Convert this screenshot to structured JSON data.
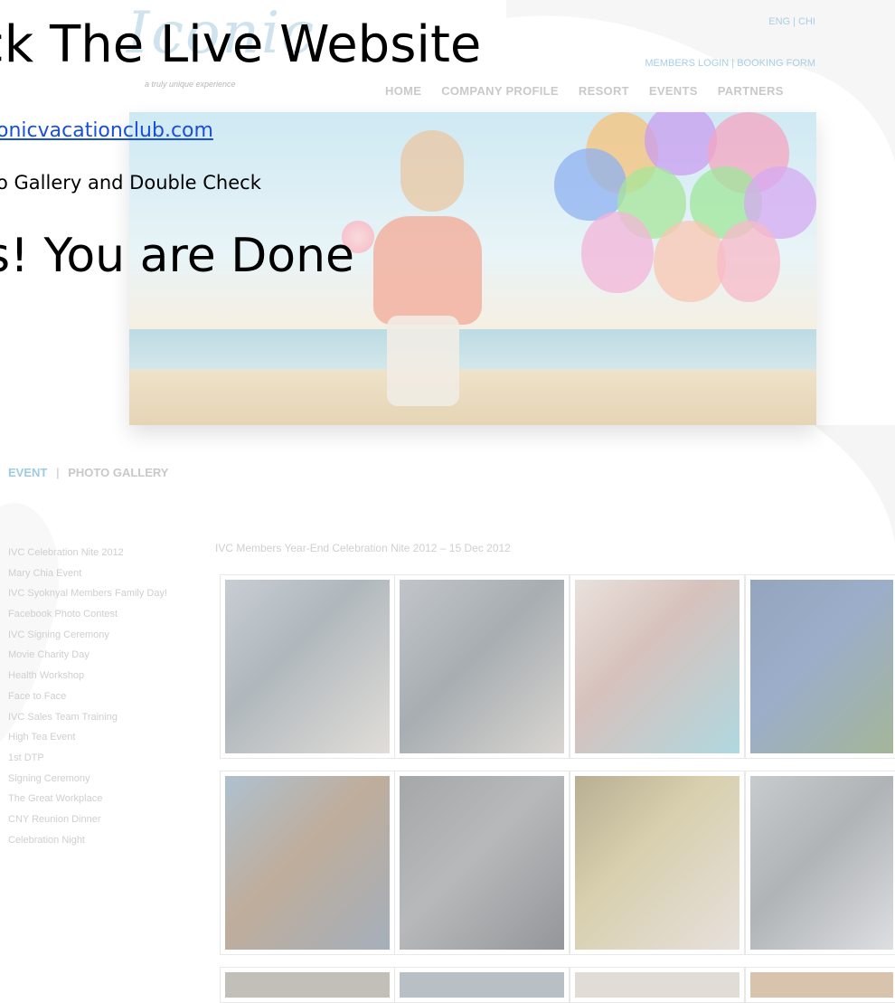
{
  "slide": {
    "heading": "ck The Live Website",
    "url": "onicvacationclub.com",
    "instruction": "o Gallery and Double Check",
    "done": "s! You are Done"
  },
  "site": {
    "lang": "ENG | CHI",
    "login_links": "MEMBERS LOGIN | BOOKING FORM",
    "tagline": "a truly unique experience",
    "nav": [
      "HOME",
      "COMPANY PROFILE",
      "RESORT",
      "EVENTS",
      "PARTNERS"
    ],
    "section": {
      "active": "EVENT",
      "separator": "|",
      "other": "PHOTO GALLERY"
    },
    "events": [
      "IVC Celebration Nite 2012",
      "Mary Chia Event",
      "IVC Syoknyal Members Family Day!",
      "Facebook Photo Contest",
      "IVC Signing Ceremony",
      "Movie Charity Day",
      "Health Workshop",
      "Face to Face",
      "IVC Sales Team Training",
      "High Tea Event",
      "1st DTP",
      "Signing Ceremony",
      "The Great Workplace",
      "CNY Reunion Dinner",
      "Celebration Night"
    ],
    "gallery_caption": "IVC Members Year-End Celebration Nite 2012 – 15 Dec 2012"
  }
}
